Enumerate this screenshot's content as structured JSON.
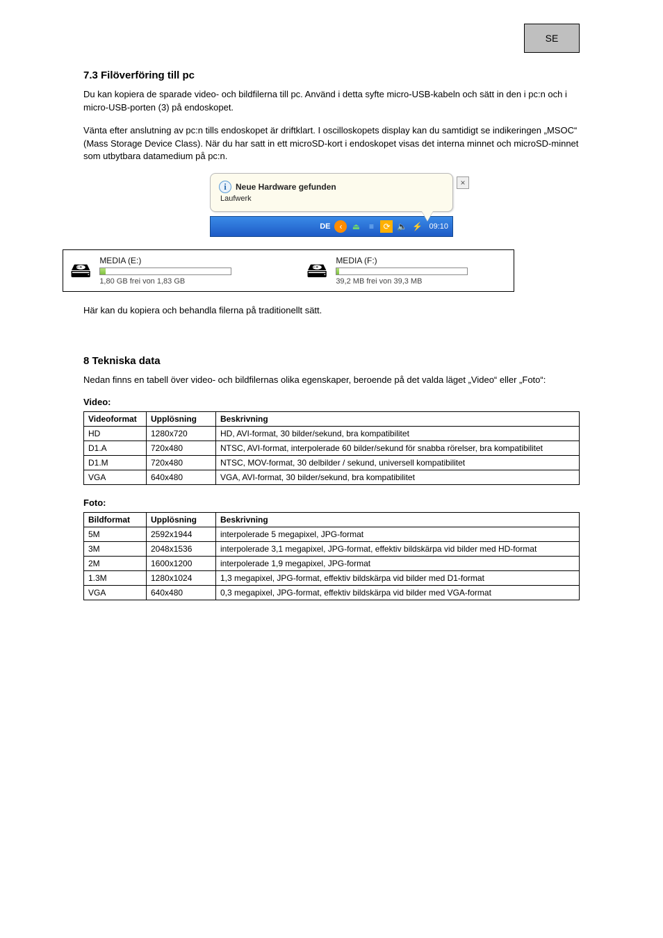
{
  "page_label": "SE",
  "section1": {
    "title": "7.3 Filöverföring till pc",
    "p1": "Du kan kopiera de sparade video- och bildfilerna till pc. Använd i detta syfte micro-USB-kabeln och sätt in den i pc:n och i micro-USB-porten (3) på endoskopet.",
    "p2": "Vänta efter anslutning av pc:n tills endoskopet är driftklart. I oscilloskopets display kan du samtidigt se indikeringen „MSOC“ (Mass Storage Device Class). När du har satt in ett microSD-kort i endoskopet visas det interna minnet och microSD-minnet som utbytbara datamedium på pc:n."
  },
  "balloon": {
    "title": "Neue Hardware gefunden",
    "subtitle": "Laufwerk",
    "close": "×"
  },
  "taskbar": {
    "lang": "DE",
    "time": "09:10"
  },
  "drives": [
    {
      "name": "MEDIA (E:)",
      "free": "1,80 GB frei von 1,83 GB",
      "fill_pct": 4
    },
    {
      "name": "MEDIA (F:)",
      "free": "39,2 MB frei von 39,3 MB",
      "fill_pct": 2
    }
  ],
  "section1_p3": "Här kan du kopiera och behandla filerna på traditionellt sätt.",
  "section2": {
    "title": "8 Tekniska data",
    "intro": "Nedan finns en tabell över video- och bildfilernas olika egenskaper, beroende på det valda läget „Video“  eller „Foto“:"
  },
  "video_table": {
    "caption": "Video:",
    "headers": [
      "Videoformat",
      "Upplösning",
      "Beskrivning"
    ],
    "rows": [
      [
        "HD",
        "1280x720",
        "HD, AVI-format, 30 bilder/sekund, bra kompatibilitet"
      ],
      [
        "D1.A",
        "720x480",
        "NTSC, AVI-format, interpolerade 60 bilder/sekund för snabba rörelser, bra kompatibilitet"
      ],
      [
        "D1.M",
        "720x480",
        "NTSC, MOV-format, 30 delbilder / sekund, universell kompatibilitet"
      ],
      [
        "VGA",
        "640x480",
        "VGA, AVI-format, 30 bilder/sekund, bra kompatibilitet"
      ]
    ]
  },
  "foto_table": {
    "caption": "Foto:",
    "headers": [
      "Bildformat",
      "Upplösning",
      "Beskrivning"
    ],
    "rows": [
      [
        "5M",
        "2592x1944",
        "interpolerade 5 megapixel, JPG-format"
      ],
      [
        "3M",
        "2048x1536",
        "interpolerade 3,1 megapixel, JPG-format, effektiv bildskärpa vid bilder med HD-format"
      ],
      [
        "2M",
        "1600x1200",
        "interpolerade 1,9 megapixel, JPG-format"
      ],
      [
        "1.3M",
        "1280x1024",
        "1,3 megapixel, JPG-format, effektiv bildskärpa vid bilder med D1-format"
      ],
      [
        "VGA",
        "640x480",
        "0,3 megapixel, JPG-format, effektiv bildskärpa vid bilder med VGA-format"
      ]
    ]
  }
}
